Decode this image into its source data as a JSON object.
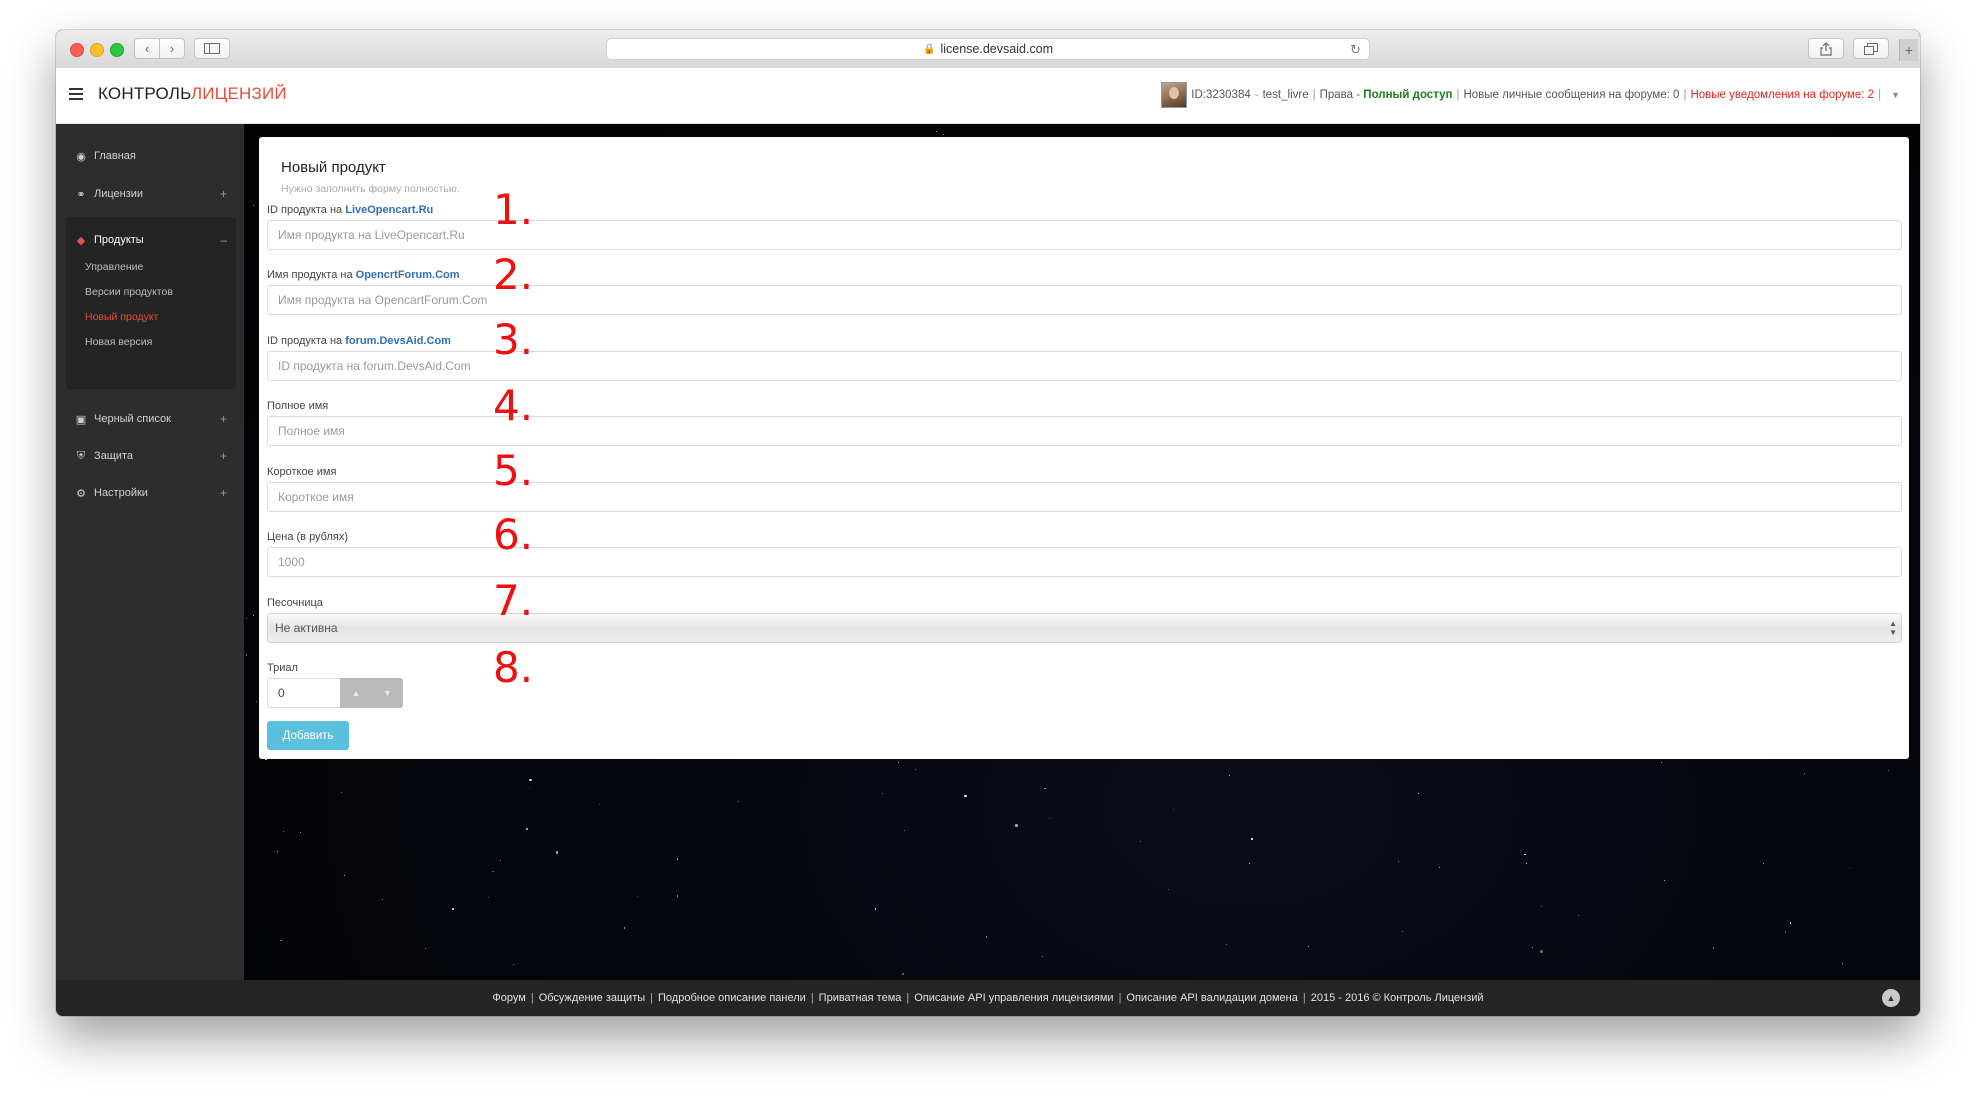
{
  "browser": {
    "url": "license.devsaid.com"
  },
  "header": {
    "brand_part1": "КОНТРОЛЬ",
    "brand_part2": "ЛИЦЕНЗИЙ",
    "user_id": "ID:3230384",
    "username": "test_livre",
    "rights_label": "Права -",
    "rights_value": "Полный доступ",
    "messages": "Новые личные сообщения на форуме: 0",
    "notifications": "Новые уведомления на форуме: 2"
  },
  "sidebar": {
    "items": [
      {
        "label": "Главная",
        "icon": "dashboard-icon"
      },
      {
        "label": "Лицензии",
        "icon": "key-icon"
      },
      {
        "label": "Продукты",
        "icon": "tags-icon"
      },
      {
        "label": "Черный список",
        "icon": "lock-icon"
      },
      {
        "label": "Защита",
        "icon": "shield-icon"
      },
      {
        "label": "Настройки",
        "icon": "gears-icon"
      }
    ],
    "products_sub": [
      {
        "label": "Управление"
      },
      {
        "label": "Версии продуктов"
      },
      {
        "label": "Новый продукт",
        "active": true
      },
      {
        "label": "Новая версия"
      }
    ]
  },
  "form": {
    "title": "Новый продукт",
    "subtitle": "Нужно заполнить форму полностью.",
    "fields": [
      {
        "label_prefix": "ID продукта на",
        "label_link": "LiveOpencart.Ru",
        "placeholder": "Имя продукта на LiveOpencart.Ru"
      },
      {
        "label_prefix": "Имя продукта на",
        "label_link": "OpencrtForum.Com",
        "placeholder": "Имя продукта на OpencartForum.Com"
      },
      {
        "label_prefix": "ID продукта на",
        "label_link": "forum.DevsAid.Com",
        "placeholder": "ID продукта на forum.DevsAid.Com"
      },
      {
        "label": "Полное имя",
        "placeholder": "Полное имя"
      },
      {
        "label": "Короткое имя",
        "placeholder": "Короткое имя"
      },
      {
        "label": "Цена (в рублях)",
        "placeholder": "1000"
      }
    ],
    "sandbox_label": "Песочница",
    "sandbox_value": "Не активна",
    "trial_label": "Триал",
    "trial_value": "0",
    "submit_label": "Добавить"
  },
  "annotations": [
    "1.",
    "2.",
    "3.",
    "4.",
    "5.",
    "6.",
    "7.",
    "8."
  ],
  "footer": {
    "links": [
      "Форум",
      "Обсуждение защиты",
      "Подробное описание панели",
      "Приватная тема",
      "Описание API управления лицензиями",
      "Описание API валидации домена"
    ],
    "copyright": "2015 - 2016 © Контроль Лицензий"
  },
  "colors": {
    "accent": "#e74c3c",
    "button": "#5bc0de",
    "annotation": "#ee0f0f"
  }
}
